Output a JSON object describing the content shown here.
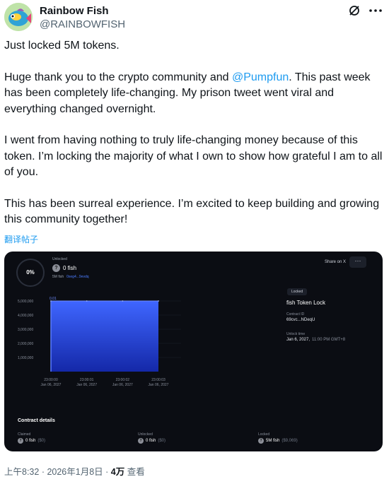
{
  "author": {
    "display_name": "Rainbow Fish",
    "handle": "@RAINBOWFISH",
    "avatar_icon": "fish-avatar-icon"
  },
  "actions": {
    "grok_icon": "grok-icon",
    "more_icon": "more-icon"
  },
  "tweet": {
    "p1": "Just locked 5M tokens.",
    "p2_pre": "Huge thank you to the crypto community and ",
    "p2_mention": "@Pumpfun",
    "p2_post": ". This past week has been completely life-changing. My prison tweet went viral and everything changed overnight.",
    "p3": "I went from having nothing to truly life-changing money because of this token. I’m locking the majority of what I own to show how grateful I am to all of you.",
    "p4": "This has been surreal experience. I’m excited to keep building and growing this community together!",
    "translate": "翻译帖子"
  },
  "card": {
    "unlocked_pct": "0%",
    "unlocked_label": "Unlocked",
    "unlocked_amount": "0 fish",
    "token_glyph": "?",
    "total_label": "5M fish",
    "total_addr": "0xeg4...9evdq",
    "share_label": "Share on X",
    "share_btn": "···",
    "lock": {
      "badge": "Locked",
      "title": "fish Token Lock",
      "contract_label": "Contract ID",
      "contract_value": "69cvc...NDeqU",
      "unlock_label": "Unlock time",
      "unlock_date": "Jan 6, 2027,",
      "unlock_time": "11:00 PM GMT+8"
    },
    "contract_title": "Contract details",
    "footer": {
      "claimed_label": "Claimed",
      "claimed_value": "0 fish",
      "claimed_sub": "($0)",
      "unlocked_label": "Unlocked",
      "unlocked_value": "0 fish",
      "unlocked_sub": "($0)",
      "locked_label": "Locked",
      "locked_value": "5M fish",
      "locked_sub": "($9,069)"
    }
  },
  "chart_data": {
    "type": "area",
    "x": [
      {
        "time": "23:00:00",
        "date": "Jan 06, 2027"
      },
      {
        "time": "23:00:01",
        "date": "Jan 06, 2027"
      },
      {
        "time": "23:00:02",
        "date": "Jan 06, 2027"
      },
      {
        "time": "23:00:03",
        "date": "Jan 06, 2027"
      }
    ],
    "yticks": [
      "5,000,000",
      "4,000,000",
      "3,000,000",
      "2,000,000",
      "1,000,000"
    ],
    "ylim": [
      0,
      5000000
    ],
    "series": [
      {
        "values": [
          5000000,
          5000000,
          5000000,
          5000000
        ]
      }
    ],
    "point_label": "0.01"
  },
  "meta": {
    "time": "上午8:32",
    "sep1": " · ",
    "date": "2026年1月8日",
    "sep2": " · ",
    "views": "4万",
    "views_suffix": " 查看"
  }
}
